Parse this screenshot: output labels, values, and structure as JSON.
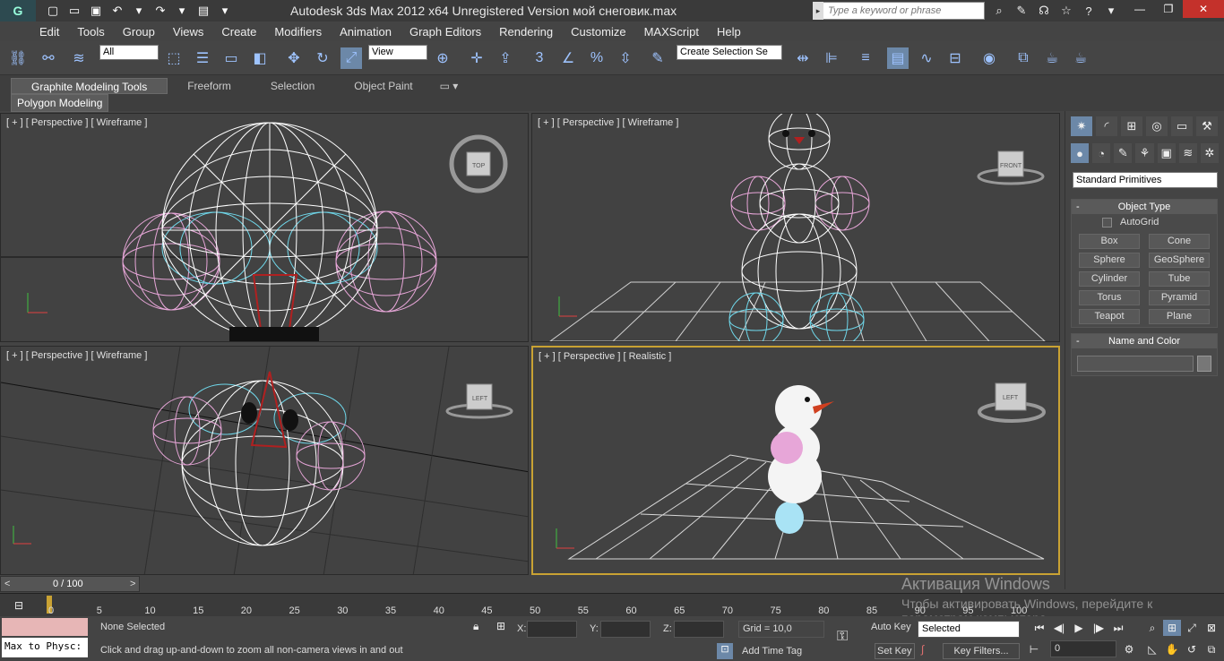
{
  "titlebar": {
    "title": "Autodesk 3ds Max  2012 x64    Unregistered Version      мой снеговик.max",
    "search_placeholder": "Type a keyword or phrase"
  },
  "menu": [
    "Edit",
    "Tools",
    "Group",
    "Views",
    "Create",
    "Modifiers",
    "Animation",
    "Graph Editors",
    "Rendering",
    "Customize",
    "MAXScript",
    "Help"
  ],
  "toolbar": {
    "filter": "All",
    "refcoord": "View",
    "selset": "Create Selection Se",
    "snap_label": "3"
  },
  "ribbon": {
    "tabs": [
      "Graphite Modeling Tools",
      "Freeform",
      "Selection",
      "Object Paint"
    ],
    "sub": "Polygon Modeling"
  },
  "viewports": [
    {
      "label": "[ + ] [ Perspective ] [ Wireframe ]",
      "cube": "TOP"
    },
    {
      "label": "[ + ] [ Perspective ] [ Wireframe ]",
      "cube": "FRONT"
    },
    {
      "label": "[ + ] [ Perspective ] [ Wireframe ]",
      "cube": "LEFT"
    },
    {
      "label": "[ + ] [ Perspective ] [ Realistic ]",
      "cube": "LEFT"
    }
  ],
  "command_panel": {
    "dropdown": "Standard Primitives",
    "object_type": "Object Type",
    "autogrid": "AutoGrid",
    "buttons": [
      "Box",
      "Cone",
      "Sphere",
      "GeoSphere",
      "Cylinder",
      "Tube",
      "Torus",
      "Pyramid",
      "Teapot",
      "Plane"
    ],
    "name_color": "Name and Color"
  },
  "time": {
    "slider": "0 / 100",
    "ticks": [
      "0",
      "5",
      "10",
      "15",
      "20",
      "25",
      "30",
      "35",
      "40",
      "45",
      "50",
      "55",
      "60",
      "65",
      "70",
      "75",
      "80",
      "85",
      "90",
      "95",
      "100"
    ]
  },
  "status": {
    "script": "Max to Physc:",
    "selected": "None Selected",
    "hint": "Click and drag up-and-down to zoom all non-camera views in and out",
    "x": "X:",
    "y": "Y:",
    "z": "Z:",
    "grid": "Grid = 10,0",
    "add_time_tag": "Add Time Tag",
    "auto_key": "Auto Key",
    "selected_dd": "Selected",
    "set_key": "Set Key",
    "key_filters": "Key Filters...",
    "frame": "0"
  },
  "watermark": {
    "line1": "Активация Windows",
    "line2": "Чтобы активировать Windows, перейдите к параметрам компьютера"
  },
  "colors": {
    "pink": "#e7a6d8",
    "cyan": "#6fd7ea",
    "white": "#ffffff",
    "red": "#b02020"
  }
}
